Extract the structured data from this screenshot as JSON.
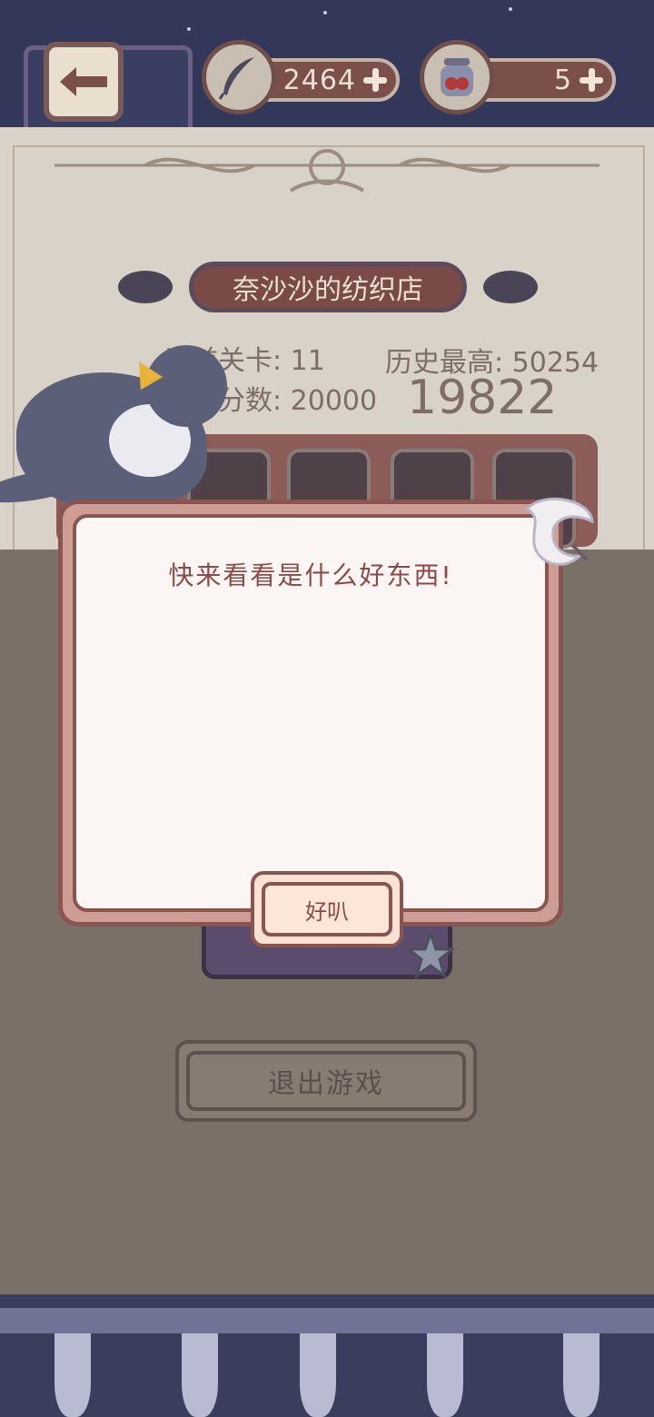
{
  "header": {
    "feathers_value": "2464",
    "potions_value": "5"
  },
  "shop": {
    "name": "奈沙沙的纺织店",
    "current_level": "当前关卡: 11",
    "history_best": "历史最高: 50254",
    "target_score": "分数: 20000",
    "current_score": "19822"
  },
  "dialog": {
    "message": "快来看看是什么好东西!",
    "ok_label": "好叭"
  },
  "exit_button": {
    "label": "退出游戏"
  },
  "colors": {
    "accent": "#8a5551",
    "dialog_bg": "#fbf5f3",
    "overlay": "#7b7068"
  }
}
